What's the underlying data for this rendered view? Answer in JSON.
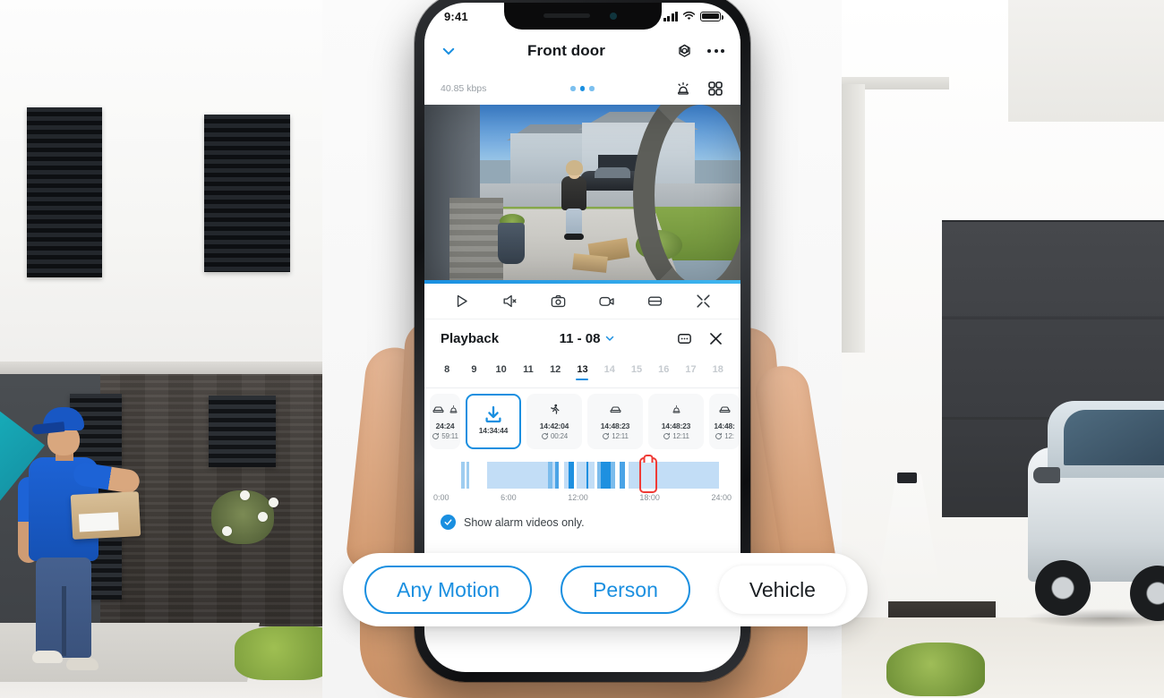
{
  "status_bar": {
    "time": "9:41",
    "signal_icon": "signal-bars-icon",
    "wifi_icon": "wifi-icon",
    "battery_icon": "battery-icon"
  },
  "header": {
    "title": "Front door",
    "back_icon": "chevron-down-icon",
    "settings_icon": "gear-icon",
    "more_icon": "more-horizontal-icon"
  },
  "sub_header": {
    "bitrate": "40.85 kbps",
    "siren_icon": "siren-icon",
    "grid_icon": "grid-view-icon",
    "page_dots": 3,
    "active_dot": 1
  },
  "video": {
    "label": "doorbell-camera-live-view"
  },
  "controls": [
    {
      "name": "play-icon",
      "label": "Play"
    },
    {
      "name": "mute-icon",
      "label": "Mute"
    },
    {
      "name": "snapshot-icon",
      "label": "Snapshot"
    },
    {
      "name": "record-icon",
      "label": "Record"
    },
    {
      "name": "quality-icon",
      "label": "Quality"
    },
    {
      "name": "fullscreen-icon",
      "label": "Fullscreen"
    }
  ],
  "playback": {
    "title": "Playback",
    "date": "11 - 08",
    "date_chevron_icon": "chevron-down-icon",
    "more_icon": "more-box-icon",
    "close_icon": "close-icon",
    "days": [
      "8",
      "9",
      "10",
      "11",
      "12",
      "13",
      "14",
      "15",
      "16",
      "17",
      "18"
    ],
    "selected_day": "13",
    "dim_from_index": 6
  },
  "events": [
    {
      "icons": [
        "vehicle-icon",
        "alarm-icon"
      ],
      "time": "24:24",
      "duration": "59:11",
      "selected": false,
      "partial": true
    },
    {
      "icons": [
        "download-icon"
      ],
      "time": "14:34:44",
      "duration": "",
      "selected": true,
      "partial": false
    },
    {
      "icons": [
        "person-icon"
      ],
      "time": "14:42:04",
      "duration": "00:24",
      "selected": false,
      "partial": false
    },
    {
      "icons": [
        "vehicle-icon"
      ],
      "time": "14:48:23",
      "duration": "12:11",
      "selected": false,
      "partial": false
    },
    {
      "icons": [
        "alarm-icon"
      ],
      "time": "14:48:23",
      "duration": "12:11",
      "selected": false,
      "partial": false
    },
    {
      "icons": [
        "vehicle-icon"
      ],
      "time": "14:48:",
      "duration": "12:",
      "selected": false,
      "partial": true
    }
  ],
  "timeline": {
    "labels": [
      "0:00",
      "6:00",
      "12:00",
      "18:00",
      "24:00"
    ],
    "playhead_hour": 17.2,
    "segments": [
      {
        "start_hour": 2.2,
        "end_hour": 2.5,
        "color": "#9fcdf0"
      },
      {
        "start_hour": 2.7,
        "end_hour": 2.9,
        "color": "#9fcdf0"
      },
      {
        "start_hour": 4.3,
        "end_hour": 10.1,
        "color": "#c2ddf6"
      },
      {
        "start_hour": 9.2,
        "end_hour": 9.6,
        "color": "#7cbcec"
      },
      {
        "start_hour": 9.8,
        "end_hour": 10.1,
        "color": "#4aa3e6"
      },
      {
        "start_hour": 10.5,
        "end_hour": 11.3,
        "color": "#c2ddf6"
      },
      {
        "start_hour": 10.9,
        "end_hour": 11.3,
        "color": "#1e90e0"
      },
      {
        "start_hour": 11.5,
        "end_hour": 13.0,
        "color": "#c2ddf6"
      },
      {
        "start_hour": 12.3,
        "end_hour": 12.5,
        "color": "#1e90e0"
      },
      {
        "start_hour": 13.2,
        "end_hour": 14.6,
        "color": "#7cbcec"
      },
      {
        "start_hour": 13.5,
        "end_hour": 14.3,
        "color": "#1e90e0"
      },
      {
        "start_hour": 15.0,
        "end_hour": 15.4,
        "color": "#4aa3e6"
      },
      {
        "start_hour": 15.7,
        "end_hour": 16.3,
        "color": "#c2ddf6"
      },
      {
        "start_hour": 16.3,
        "end_hour": 23.0,
        "color": "#c2ddf6"
      }
    ]
  },
  "alarm_filter": {
    "checkbox_icon": "check-circle-icon",
    "label": "Show alarm videos only.",
    "checked": true
  },
  "filter_pills": [
    {
      "label": "Any Motion",
      "state": "active"
    },
    {
      "label": "Person",
      "state": "active"
    },
    {
      "label": "Vehicle",
      "state": "plain"
    }
  ],
  "colors": {
    "accent": "#1a8fe0",
    "playhead": "#ef3b36",
    "text": "#14181c",
    "muted": "#8a9197"
  }
}
